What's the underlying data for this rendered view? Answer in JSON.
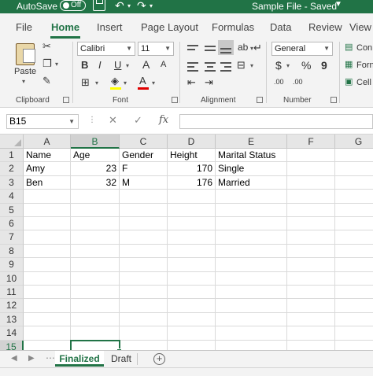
{
  "titlebar": {
    "autosave_label": "AutoSave",
    "autosave_state": "Off",
    "filename": "Sample File  -  Saved"
  },
  "ribbon_tabs": [
    {
      "label": "File"
    },
    {
      "label": "Home",
      "active": true
    },
    {
      "label": "Insert"
    },
    {
      "label": "Page Layout"
    },
    {
      "label": "Formulas"
    },
    {
      "label": "Data"
    },
    {
      "label": "Review"
    },
    {
      "label": "View"
    }
  ],
  "ribbon": {
    "clipboard": {
      "paste_label": "Paste",
      "group_label": "Clipboard"
    },
    "font": {
      "font_name": "Calibri",
      "font_size": "11",
      "bold": "B",
      "italic": "I",
      "underline": "U",
      "grow": "A",
      "shrink": "A",
      "group_label": "Font"
    },
    "alignment": {
      "group_label": "Alignment"
    },
    "number": {
      "format": "General",
      "currency": "$",
      "percent": "%",
      "comma": "9",
      "inc_decimal": ".00",
      "dec_decimal": ".00",
      "group_label": "Number"
    },
    "styles": {
      "conditional": "Con",
      "format_table": "Forn",
      "cell_styles": "Cell"
    }
  },
  "formula_bar": {
    "name_box": "B15",
    "cancel": "✕",
    "enter": "✓",
    "fx": "fx",
    "formula": ""
  },
  "sheet": {
    "columns": [
      "A",
      "B",
      "C",
      "D",
      "E",
      "F",
      "G"
    ],
    "rows": [
      "1",
      "2",
      "3",
      "4",
      "5",
      "6",
      "7",
      "8",
      "9",
      "10",
      "11",
      "12",
      "13",
      "14",
      "15"
    ],
    "selected_column": "B",
    "selected_row": "15",
    "cells": [
      [
        "Name",
        "Age",
        "Gender",
        "Height",
        "Marital Status",
        "",
        ""
      ],
      [
        "Amy",
        "23",
        "F",
        "170",
        "Single",
        "",
        ""
      ],
      [
        "Ben",
        "32",
        "M",
        "176",
        "Married",
        "",
        ""
      ]
    ]
  },
  "sheet_tabs": [
    {
      "label": "Finalized",
      "active": true
    },
    {
      "label": "Draft"
    }
  ],
  "colors": {
    "accent": "#217346"
  }
}
